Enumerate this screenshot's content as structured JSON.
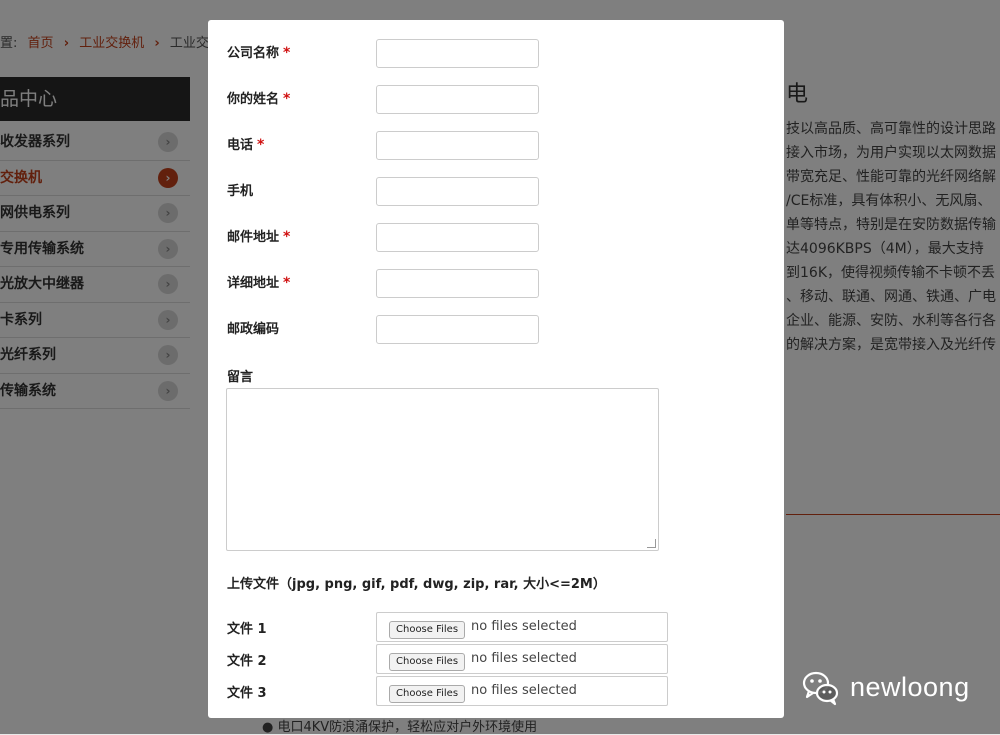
{
  "breadcrumb": {
    "prefix": "置:",
    "home": "首页",
    "sep": "›",
    "category": "工业交换机",
    "current": "工业交"
  },
  "sidebar": {
    "title": "品中心",
    "items": [
      {
        "label": "收发器系列"
      },
      {
        "label": "交换机"
      },
      {
        "label": "网供电系列"
      },
      {
        "label": "专用传输系统"
      },
      {
        "label": "光放大中继器"
      },
      {
        "label": "卡系列"
      },
      {
        "label": "光纤系列"
      },
      {
        "label": "传输系统"
      }
    ]
  },
  "content": {
    "title": "电",
    "lines": [
      "技以高品质、高可靠性的设计思路",
      "接入市场，为用户实现以太网数据",
      "带宽充足、性能可靠的光纤网络解",
      "/CE标准，具有体积小、无风扇、",
      "单等特点，特别是在安防数据传输",
      "达4096KBPS（4M），最大支持",
      "到16K，使得视频传输不卡顿不丢",
      "、移动、联通、网通、铁通、广电",
      "企业、能源、安防、水利等各行各",
      "的解决方案，是宽带接入及光纤传"
    ],
    "footer_bullet": "●  电口4KV防浪涌保护，轻松应对户外环境使用"
  },
  "form": {
    "fields": [
      {
        "label": "公司名称",
        "required": "*"
      },
      {
        "label": "你的姓名",
        "required": "*"
      },
      {
        "label": "电话",
        "required": "*"
      },
      {
        "label": "手机",
        "required": ""
      },
      {
        "label": "邮件地址",
        "required": "*"
      },
      {
        "label": "详细地址",
        "required": "*"
      },
      {
        "label": "邮政编码",
        "required": ""
      }
    ],
    "message_label": "留言",
    "upload_title": "上传文件（jpg, png, gif, pdf, dwg, zip, rar, 大小<=2M）",
    "files": [
      {
        "label": "文件 1",
        "button": "Choose Files",
        "status": "no files selected"
      },
      {
        "label": "文件 2",
        "button": "Choose Files",
        "status": "no files selected"
      },
      {
        "label": "文件 3",
        "button": "Choose Files",
        "status": "no files selected"
      }
    ]
  },
  "watermark": {
    "icon": "wechat-icon",
    "text": "newloong"
  },
  "colors": {
    "accent": "#c4401a",
    "required": "#d01010",
    "sidebar_header": "#2b2b2b"
  }
}
